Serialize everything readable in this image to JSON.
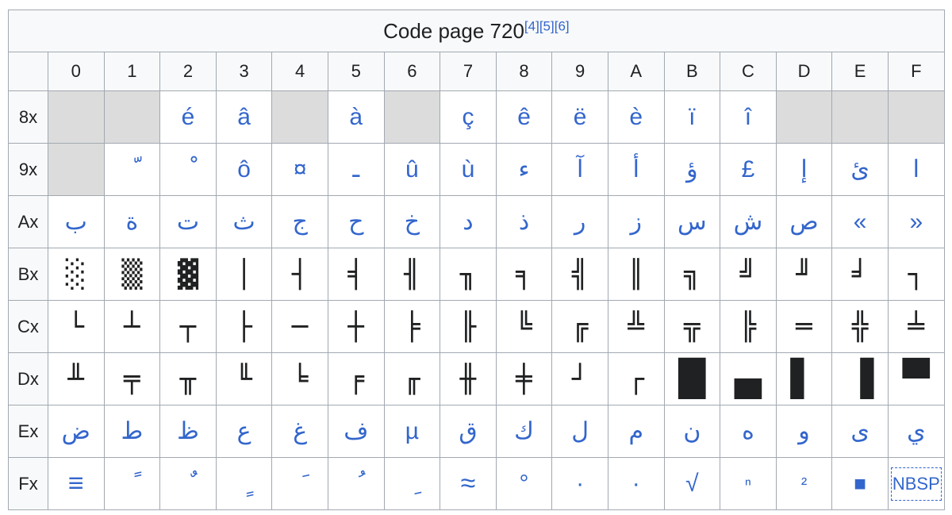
{
  "title": "Code page 720",
  "refs": [
    "[4]",
    "[5]",
    "[6]"
  ],
  "columns": [
    "0",
    "1",
    "2",
    "3",
    "4",
    "5",
    "6",
    "7",
    "8",
    "9",
    "A",
    "B",
    "C",
    "D",
    "E",
    "F"
  ],
  "rows": [
    {
      "label": "8x",
      "cells": [
        "",
        "",
        "é",
        "â",
        "",
        "à",
        "",
        "ç",
        "ê",
        "ë",
        "è",
        "ï",
        "î",
        "",
        "",
        ""
      ]
    },
    {
      "label": "9x",
      "cells": [
        "",
        "ّ",
        "ْ",
        "ô",
        "¤",
        "ـ",
        "û",
        "ù",
        "ء",
        "آ",
        "أ",
        "ؤ",
        "£",
        "إ",
        "ئ",
        "ا"
      ]
    },
    {
      "label": "Ax",
      "cells": [
        "ب",
        "ة",
        "ت",
        "ث",
        "ج",
        "ح",
        "خ",
        "د",
        "ذ",
        "ر",
        "ز",
        "س",
        "ش",
        "ص",
        "«",
        "»"
      ]
    },
    {
      "label": "Bx",
      "cells": [
        "░",
        "▒",
        "▓",
        "│",
        "┤",
        "╡",
        "╢",
        "╖",
        "╕",
        "╣",
        "║",
        "╗",
        "╝",
        "╜",
        "╛",
        "┐"
      ]
    },
    {
      "label": "Cx",
      "cells": [
        "└",
        "┴",
        "┬",
        "├",
        "─",
        "┼",
        "╞",
        "╟",
        "╚",
        "╔",
        "╩",
        "╦",
        "╠",
        "═",
        "╬",
        "╧"
      ]
    },
    {
      "label": "Dx",
      "cells": [
        "╨",
        "╤",
        "╥",
        "╙",
        "╘",
        "╒",
        "╓",
        "╫",
        "╪",
        "┘",
        "┌",
        "█",
        "▄",
        "▌",
        "▐",
        "▀"
      ]
    },
    {
      "label": "Ex",
      "cells": [
        "ض",
        "ط",
        "ظ",
        "ع",
        "غ",
        "ف",
        "µ",
        "ق",
        "ك",
        "ل",
        "م",
        "ن",
        "ه",
        "و",
        "ى",
        "ي"
      ]
    },
    {
      "label": "Fx",
      "cells": [
        "≡",
        "ً",
        "ٌ",
        "ٍ",
        "َ",
        "ُ",
        "ِ",
        "≈",
        "°",
        "∙",
        "·",
        "√",
        "ⁿ",
        "²",
        "■",
        "NBSP"
      ]
    }
  ]
}
